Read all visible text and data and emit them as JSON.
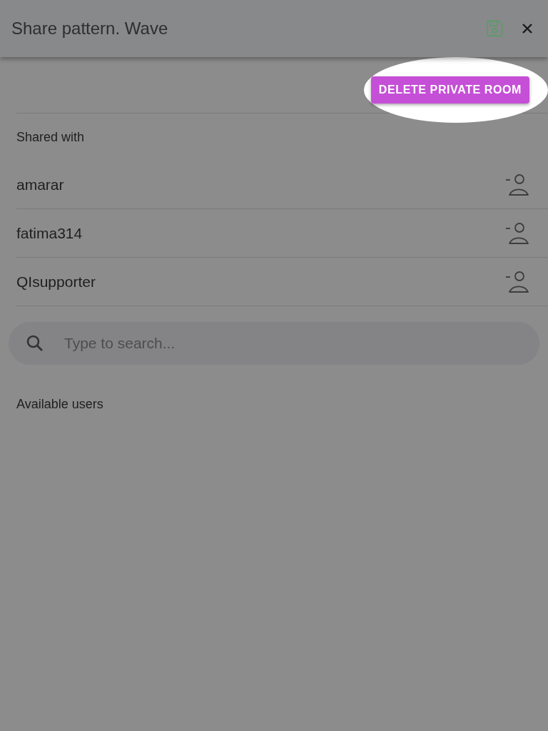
{
  "header": {
    "title": "Share pattern. Wave"
  },
  "delete_button": {
    "label": "DELETE PRIVATE ROOM"
  },
  "shared_with": {
    "heading": "Shared with",
    "users": [
      {
        "name": "amarar"
      },
      {
        "name": "fatima314"
      },
      {
        "name": "QIsupporter"
      }
    ]
  },
  "search": {
    "placeholder": "Type to search..."
  },
  "available_users": {
    "heading": "Available users"
  }
}
